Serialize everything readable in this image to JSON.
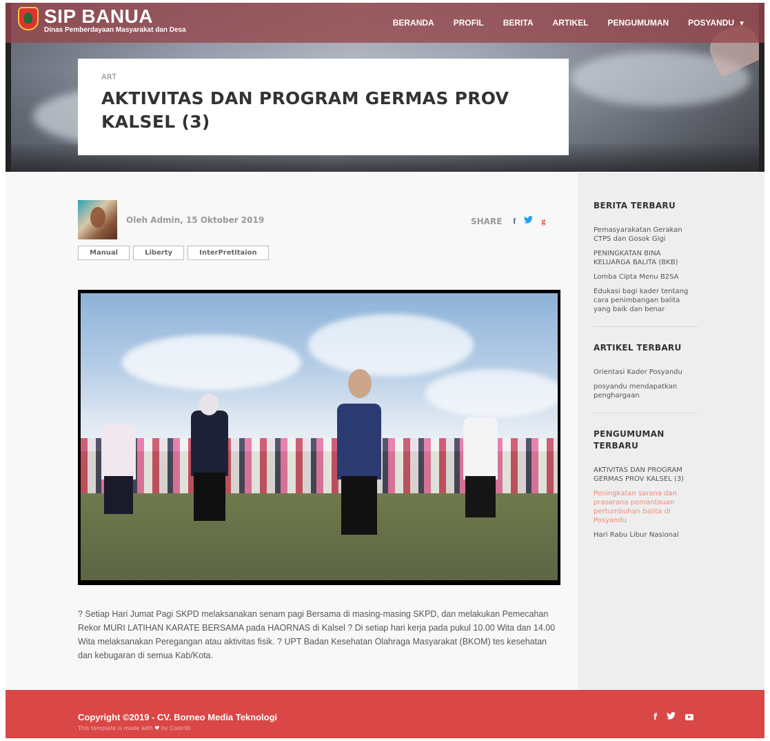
{
  "brand": {
    "title": "SIP BANUA",
    "subtitle": "Dinas Pemberdayaan Masyarakat dan Desa"
  },
  "nav": {
    "items": [
      {
        "label": "BERANDA"
      },
      {
        "label": "PROFIL"
      },
      {
        "label": "BERITA"
      },
      {
        "label": "ARTIKEL"
      },
      {
        "label": "PENGUMUMAN"
      },
      {
        "label": "POSYANDU"
      }
    ],
    "dropdown_caret": "▼"
  },
  "post": {
    "category": "ART",
    "title": "AKTIVITAS DAN PROGRAM GERMAS PROV KALSEL (3)",
    "byline": "Oleh Admin, 15 Oktober 2019",
    "share_label": "SHARE",
    "share_icons": {
      "facebook": "f",
      "twitter": "🐦",
      "google": "g"
    },
    "tags": [
      "Manual",
      "Liberty",
      "InterPretitaion"
    ],
    "body": "? Setiap Hari Jumat Pagi SKPD melaksanakan senam pagi Bersama di masing-masing SKPD, dan melakukan Pemecahan Rekor MURI LATIHAN KARATE BERSAMA pada HAORNAS di Kalsel ? Di setiap hari kerja pada pukul 10.00 Wita dan 14.00 Wita melaksanakan Peregangan atau aktivitas fisik. ? UPT Badan Kesehatan Olahraga Masyarakat (BKOM) tes kesehatan dan kebugaran di semua Kab/Kota."
  },
  "sidebar": {
    "berita": {
      "heading": "BERITA TERBARU",
      "items": [
        "Pemasyarakatan Gerakan CTPS dan Gosok Gigi",
        "PENINGKATAN BINA KELUARGA BALITA (BKB)",
        "Lomba Cipta Menu B2SA",
        "Edukasi bagi kader tentang cara penimbangan balita yang baik dan benar"
      ]
    },
    "artikel": {
      "heading": "ARTIKEL TERBARU",
      "items": [
        "Orientasi Kader Posyandu",
        "posyandu mendapatkan penghargaan"
      ]
    },
    "pengumuman": {
      "heading": "PENGUMUMAN TERBARU",
      "items": [
        "AKTIVITAS DAN PROGRAM GERMAS PROV KALSEL (3)",
        "Peningkatan sarana dan prasarana pemantauan pertumbuhan balita di Posyandu",
        "Hari Rabu Libur Nasional"
      ]
    }
  },
  "footer": {
    "copyright": "Copyright ©2019 - CV. Borneo Media Teknologi",
    "made_with_prefix": "This template is made with",
    "made_with_heart": "♥",
    "made_with_suffix": "by Colorlib",
    "icons": {
      "facebook": "f",
      "twitter": "🐦"
    }
  },
  "colors": {
    "accent_red": "#d94747",
    "active_link": "#ee8a7a",
    "facebook": "#3b5998",
    "twitter": "#1da1f2",
    "google": "#dd4b39"
  }
}
